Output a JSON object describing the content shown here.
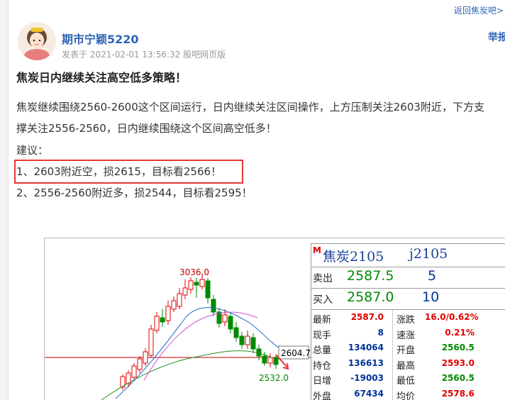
{
  "header": {
    "return_link": "返回焦炭吧>"
  },
  "author": {
    "name": "期市宁颖5220",
    "report_label": "举报",
    "avatar_icon": "avatar-girl-icon"
  },
  "post_meta": {
    "published_label": "发表于",
    "datetime": "2021-02-01 13:56:32",
    "client": "股吧网页版"
  },
  "post": {
    "title": "焦炭日内继续关注高空低多策略！",
    "lines": [
      "焦炭继续围绕2560-2600这个区间运行，日内继续关注区间操作，上方压制关注2603附近，下方支",
      "撑关注2556-2560，日内继续围绕这个区间高空低多！",
      "建议：",
      "1、2603附近空，损2615，目标看2566！",
      "2、2556-2560附近多，损2544，目标看2595！"
    ]
  },
  "colors": {
    "link": "#2d64b3",
    "up": "#e00000",
    "down": "#008a00",
    "highlight": "#e53935",
    "blue_value": "#003399"
  },
  "chart": {
    "high_label": "3036.0",
    "low_label": "2532.0",
    "price_tag": "2604.7",
    "up_color": "#e00000",
    "down_color": "#008a00"
  },
  "quote": {
    "badge": "M",
    "title": "焦炭2105",
    "code": "j2105",
    "ask_label": "卖出",
    "ask_price": "2587.5",
    "ask_vol": "5",
    "bid_label": "买入",
    "bid_price": "2587.0",
    "bid_vol": "10",
    "stats": [
      {
        "label": "最新",
        "value": "2587.0",
        "color": "#e00000",
        "label2": "涨跌",
        "value2": "16.0/0.62%",
        "color2": "#e00000"
      },
      {
        "label": "现手",
        "value": "8",
        "color": "#003399",
        "label2": "速涨",
        "value2": "0.21%",
        "color2": "#e00000"
      },
      {
        "label": "总量",
        "value": "134064",
        "color": "#003399",
        "label2": "开盘",
        "value2": "2560.5",
        "color2": "#008a00"
      },
      {
        "label": "持仓",
        "value": "136613",
        "color": "#003399",
        "label2": "最高",
        "value2": "2593.0",
        "color2": "#e00000"
      },
      {
        "label": "日增",
        "value": "-19003",
        "color": "#003399",
        "label2": "最低",
        "value2": "2560.5",
        "color2": "#008a00"
      },
      {
        "label": "外盘",
        "value": "67434",
        "color": "#003399",
        "label2": "均价",
        "value2": "2578.6",
        "color2": "#e00000"
      }
    ]
  }
}
